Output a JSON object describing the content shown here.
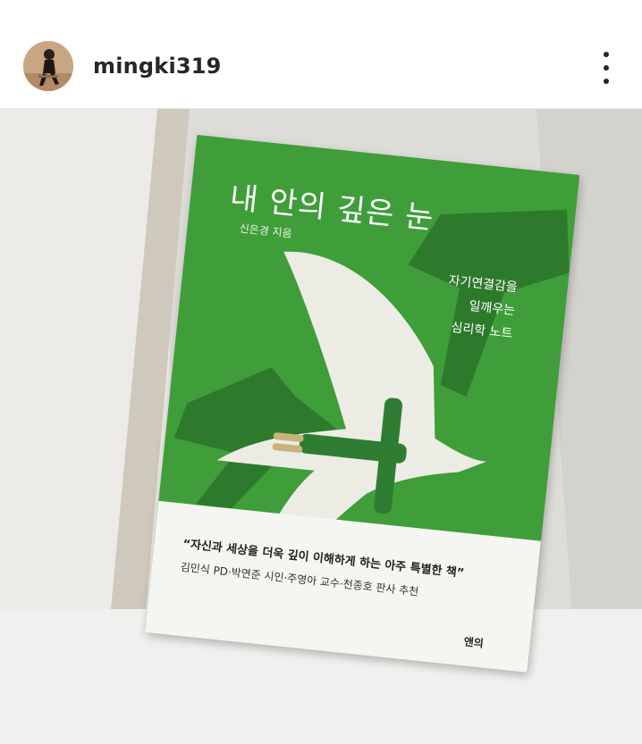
{
  "post": {
    "username": "mingki319",
    "avatar_icon": "profile-avatar",
    "more_icon": "vertical-ellipsis-icon"
  },
  "book": {
    "title": "내 안의 깊은 눈",
    "author": "신은경 지음",
    "subtitle_lines": [
      "자기연결감을",
      "일깨우는",
      "심리학 노트"
    ],
    "band_quote": "“자신과 세상을 더욱 깊이 이해하게 하는 아주 특별한 책”",
    "band_recommenders": "김민식 PD·박연준 시인·주영아 교수·천종호 판사 추천",
    "publisher": "앤의",
    "cover_color": "#3f9e3a"
  }
}
